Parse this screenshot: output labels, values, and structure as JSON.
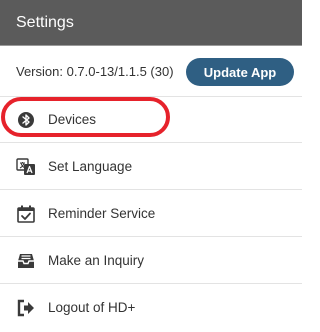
{
  "header": {
    "title": "Settings"
  },
  "version": {
    "text": "Version: 0.7.0-13/1.1.5 (30)",
    "update_label": "Update App"
  },
  "menu": {
    "items": [
      {
        "label": "Devices",
        "icon": "bluetooth-icon"
      },
      {
        "label": "Set Language",
        "icon": "language-icon"
      },
      {
        "label": "Reminder Service",
        "icon": "calendar-check-icon"
      },
      {
        "label": "Make an Inquiry",
        "icon": "inbox-icon"
      },
      {
        "label": "Logout of HD+",
        "icon": "logout-icon"
      }
    ]
  },
  "colors": {
    "header_bg": "#5b5b5b",
    "button_bg": "#2f5f83",
    "highlight": "#e6222b"
  }
}
